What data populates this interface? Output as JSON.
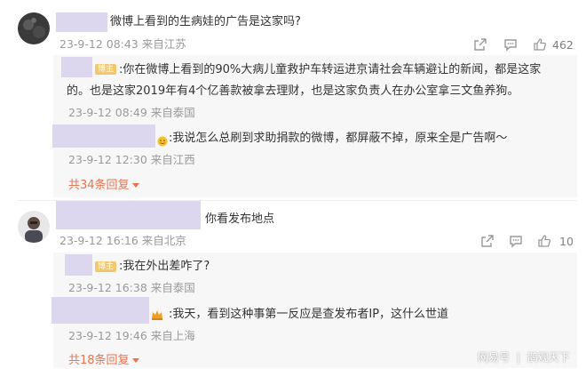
{
  "comments": [
    {
      "text": "微博上看到的生病娃的广告是这家吗?",
      "meta": "23-9-12 08:43 来自江苏",
      "actions": {
        "share": "share-icon",
        "comment": "comment-icon",
        "like": "like-icon",
        "like_count": "462"
      },
      "replies": [
        {
          "badge": "博主",
          "line1": ":你在微博上看到的90%大病儿童救护车转运进京请社会车辆避让的新闻，都是这家",
          "line2": "的。也是这家2019年有4个亿善款被拿去理财，也是这家负责人在办公室拿三文鱼养狗。",
          "meta": "23-9-12 08:49 来自泰国"
        },
        {
          "emoji": "smiley",
          "text": ":我说怎么总刷到求助捐款的微博，都屏蔽不掉，原来全是广告啊～",
          "meta": "23-9-12 12:30 来自江西"
        }
      ],
      "more": "共34条回复"
    },
    {
      "text": "你看发布地点",
      "meta": "23-9-12 16:16 来自北京",
      "actions": {
        "share": "share-icon",
        "comment": "comment-icon",
        "like": "like-icon",
        "like_count": "10"
      },
      "replies": [
        {
          "badge": "博主",
          "text": ":我在外出差咋了?",
          "meta": "23-9-12 16:38 来自泰国"
        },
        {
          "emoji": "crown",
          "text": ":我天，看到这种事第一反应是查发布者IP，这什么世道",
          "meta": "23-9-12 19:46 来自上海"
        }
      ],
      "more": "共18条回复"
    }
  ],
  "watermark": {
    "left": "网易号",
    "right": "鹊观天下"
  }
}
